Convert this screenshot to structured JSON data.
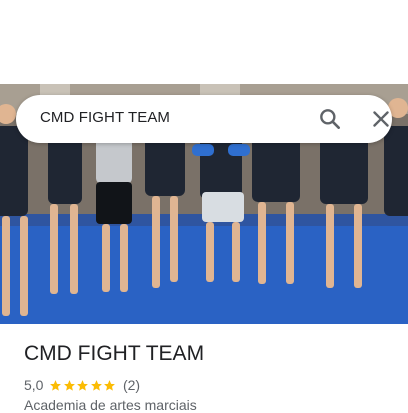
{
  "search": {
    "query": "CMD FIGHT TEAM"
  },
  "place": {
    "title": "CMD FIGHT TEAM",
    "rating": "5,0",
    "stars": 5,
    "review_count": "(2)",
    "category": "Academia de artes marciais"
  },
  "hero_photo": {
    "subject": "group of martial artists standing on blue mats"
  },
  "colors": {
    "star": "#fbbc04",
    "mat_blue": "#2563c8",
    "title_text": "#202124",
    "secondary_text": "#5f6368"
  },
  "icons": {
    "search": "search-icon",
    "close": "close-icon",
    "star": "star-icon"
  }
}
